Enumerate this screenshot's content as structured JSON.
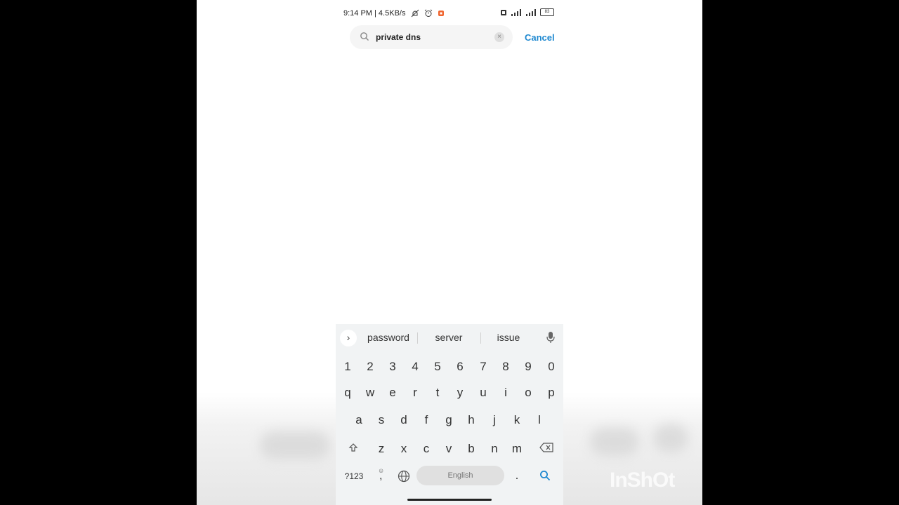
{
  "status_bar": {
    "time_speed": "9:14 PM | 4.5KB/s",
    "battery": "83"
  },
  "search": {
    "value": "private dns",
    "clear_icon": "×"
  },
  "cancel_label": "Cancel",
  "keyboard": {
    "suggestions": [
      "password",
      "server",
      "issue"
    ],
    "number_row": [
      "1",
      "2",
      "3",
      "4",
      "5",
      "6",
      "7",
      "8",
      "9",
      "0"
    ],
    "row1": [
      "q",
      "w",
      "e",
      "r",
      "t",
      "y",
      "u",
      "i",
      "o",
      "p"
    ],
    "row2": [
      "a",
      "s",
      "d",
      "f",
      "g",
      "h",
      "j",
      "k",
      "l"
    ],
    "row3": [
      "z",
      "x",
      "c",
      "v",
      "b",
      "n",
      "m"
    ],
    "symbols_label": "?123",
    "comma_label": ",",
    "space_label": "English",
    "period_label": ".",
    "accent_color": "#1e88d0"
  },
  "watermark": "InShOt"
}
